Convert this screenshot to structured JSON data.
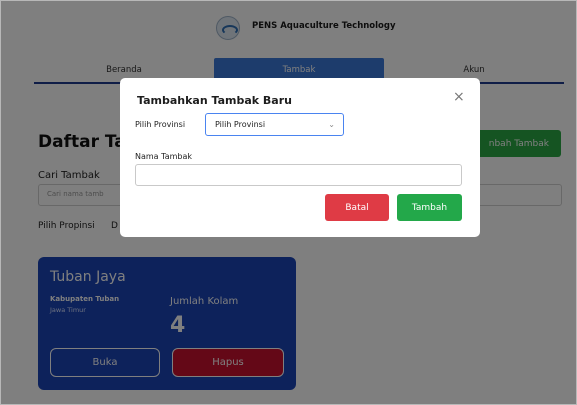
{
  "header": {
    "brand": "PENS Aquaculture Technology",
    "logo_icon": "shrimp-logo-icon"
  },
  "nav": {
    "home": "Beranda",
    "add": "Tambak",
    "account": "Akun"
  },
  "page": {
    "title": "Daftar Tambak",
    "title_visible": "Daftar Ta",
    "add_button": "Tambah Tambak",
    "add_button_visible": "nbah Tambak",
    "search_label": "Cari Tambak",
    "search_placeholder": "Cari nama tambak...",
    "search_placeholder_visible": "Cari nama tamb",
    "filter_label": "Pilih Propinsi",
    "filter_partial": "D"
  },
  "card": {
    "title": "Tuban Jaya",
    "district": "Kabupaten Tuban",
    "province": "Jawa Timur",
    "ponds_label": "Jumlah Kolam",
    "ponds_count": "4",
    "open_button": "Buka",
    "delete_button": "Hapus"
  },
  "modal": {
    "title": "Tambahkan Tambak Baru",
    "province_label": "Pilih Provinsi",
    "province_value": "Pilih Provinsi",
    "name_label": "Nama Tambak",
    "name_value": "",
    "cancel_button": "Batal",
    "submit_button": "Tambah"
  },
  "colors": {
    "primary": "#1b44b6",
    "nav_active": "#3b78d8",
    "success": "#2aa844",
    "danger": "#df3b45"
  }
}
